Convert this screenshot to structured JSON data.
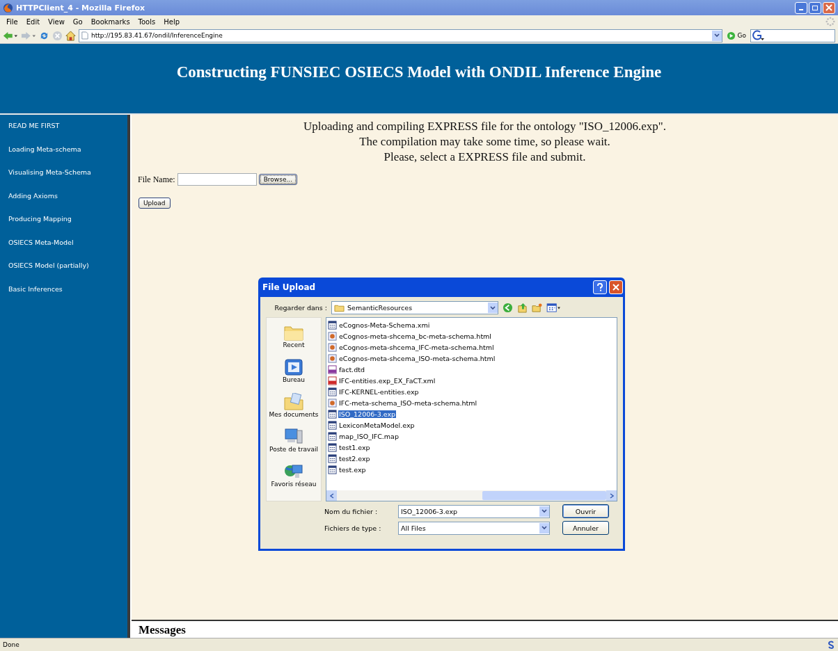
{
  "window": {
    "title": "HTTPClient_4 - Mozilla Firefox"
  },
  "menu": [
    "File",
    "Edit",
    "View",
    "Go",
    "Bookmarks",
    "Tools",
    "Help"
  ],
  "address": {
    "value": "http://195.83.41.67/ondil/InferenceEngine",
    "go": "Go"
  },
  "header": {
    "title": "Constructing FUNSIEC OSIECS Model with ONDIL Inference Engine"
  },
  "sidebar": {
    "items": [
      {
        "label": "READ ME FIRST"
      },
      {
        "label": "Loading Meta-schema"
      },
      {
        "label": "Visualising Meta-Schema"
      },
      {
        "label": "Adding Axioms"
      },
      {
        "label": "Producing Mapping"
      },
      {
        "label": "OSIECS Meta-Model"
      },
      {
        "label": "OSIECS Model (partially)"
      },
      {
        "label": "Basic Inferences"
      }
    ]
  },
  "intro": [
    "Uploading and compiling EXPRESS file for the ontology \"ISO_12006.exp\".",
    "The compilation may take some time, so please wait.",
    "Please, select a EXPRESS file and submit."
  ],
  "form": {
    "label": "File Name:",
    "browse": "Browse...",
    "upload": "Upload"
  },
  "messages": {
    "title": "Messages"
  },
  "dialog": {
    "title": "File Upload",
    "look_in_label": "Regarder dans :",
    "look_in": "SemanticResources",
    "places": [
      {
        "label": "Recent",
        "kind": "folder"
      },
      {
        "label": "Bureau",
        "kind": "desktop"
      },
      {
        "label": "Mes documents",
        "kind": "documents"
      },
      {
        "label": "Poste de travail",
        "kind": "computer"
      },
      {
        "label": "Favoris réseau",
        "kind": "network"
      }
    ],
    "files": [
      {
        "name": "eCognos-Meta-Schema.xmi",
        "kind": "doc",
        "selected": false
      },
      {
        "name": "eCognos-meta-shcema_bc-meta-schema.html",
        "kind": "web",
        "selected": false
      },
      {
        "name": "eCognos-meta-shcema_IFC-meta-schema.html",
        "kind": "web",
        "selected": false
      },
      {
        "name": "eCognos-meta-shcema_ISO-meta-schema.html",
        "kind": "web",
        "selected": false
      },
      {
        "name": "fact.dtd",
        "kind": "dtd",
        "selected": false
      },
      {
        "name": "IFC-entities.exp_EX_FaCT.xml",
        "kind": "xml",
        "selected": false
      },
      {
        "name": "IFC-KERNEL-entities.exp",
        "kind": "doc",
        "selected": false
      },
      {
        "name": "IFC-meta-schema_ISO-meta-schema.html",
        "kind": "web",
        "selected": false
      },
      {
        "name": "ISO_12006-3.exp",
        "kind": "doc",
        "selected": true
      },
      {
        "name": "LexiconMetaModel.exp",
        "kind": "doc",
        "selected": false
      },
      {
        "name": "map_ISO_IFC.map",
        "kind": "doc",
        "selected": false
      },
      {
        "name": "test1.exp",
        "kind": "doc",
        "selected": false
      },
      {
        "name": "test2.exp",
        "kind": "doc",
        "selected": false
      },
      {
        "name": "test.exp",
        "kind": "doc",
        "selected": false
      }
    ],
    "filename_label": "Nom du fichier :",
    "filename": "ISO_12006-3.exp",
    "type_label": "Fichiers de type :",
    "type": "All Files",
    "open": "Ouvrir",
    "cancel": "Annuler"
  },
  "status_bar": {
    "text": "Done"
  }
}
